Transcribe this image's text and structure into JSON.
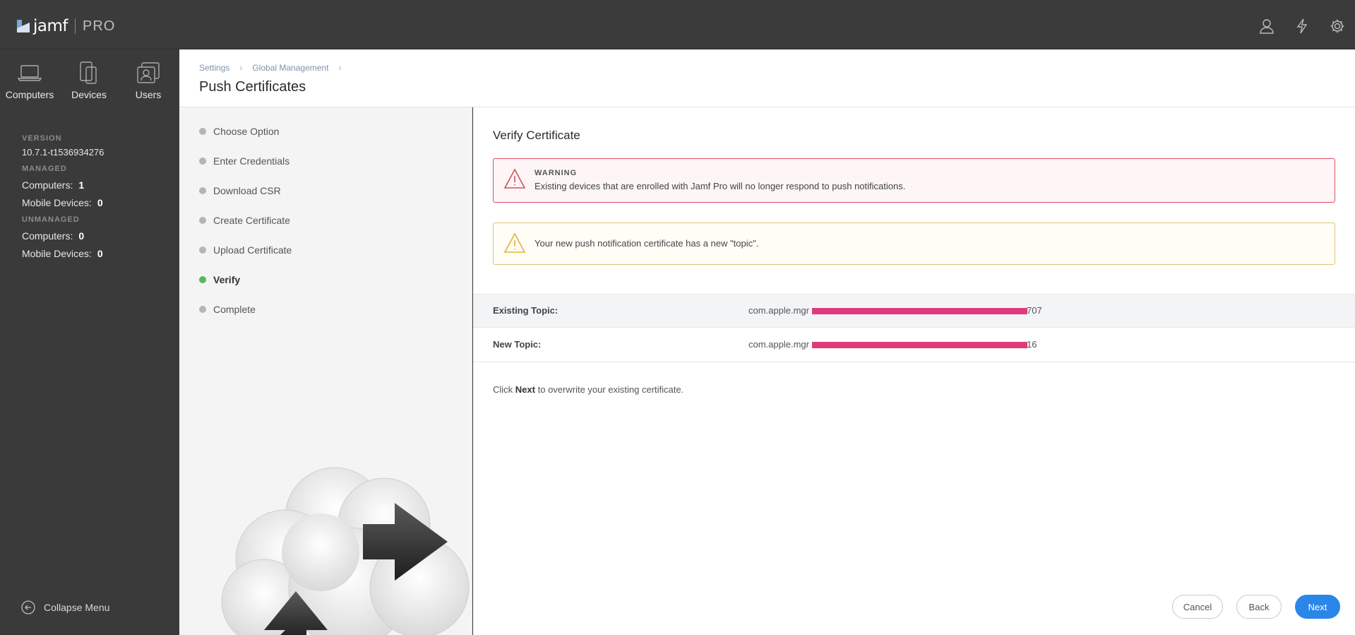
{
  "app": {
    "brand": "jamf",
    "product": "PRO"
  },
  "nav": [
    {
      "label": "Computers",
      "icon": "laptop-icon"
    },
    {
      "label": "Devices",
      "icon": "mobile-device-icon"
    },
    {
      "label": "Users",
      "icon": "users-icon"
    }
  ],
  "stats": {
    "version_label": "VERSION",
    "version": "10.7.1-t1536934276",
    "managed_label": "MANAGED",
    "unmanaged_label": "UNMANAGED",
    "managed_computers_label": "Computers:",
    "managed_computers": "1",
    "managed_mobile_label": "Mobile Devices:",
    "managed_mobile": "0",
    "unmanaged_computers_label": "Computers:",
    "unmanaged_computers": "0",
    "unmanaged_mobile_label": "Mobile Devices:",
    "unmanaged_mobile": "0"
  },
  "collapse_label": "Collapse Menu",
  "header": {
    "breadcrumb": [
      "Settings",
      "Global Management"
    ],
    "title": "Push Certificates"
  },
  "steps": [
    {
      "label": "Choose Option",
      "active": false
    },
    {
      "label": "Enter Credentials",
      "active": false
    },
    {
      "label": "Download CSR",
      "active": false
    },
    {
      "label": "Create Certificate",
      "active": false
    },
    {
      "label": "Upload Certificate",
      "active": false
    },
    {
      "label": "Verify",
      "active": true
    },
    {
      "label": "Complete",
      "active": false
    }
  ],
  "content": {
    "title": "Verify Certificate",
    "warning_title": "WARNING",
    "warning_text": "Existing devices that are enrolled with Jamf Pro will no longer respond to push notifications.",
    "info_text": "Your new push notification certificate has a new \"topic\".",
    "existing_topic_label": "Existing Topic:",
    "existing_topic_prefix": "com.apple.mgr",
    "existing_topic_suffix": "707",
    "new_topic_label": "New Topic:",
    "new_topic_prefix": "com.apple.mgr",
    "new_topic_suffix": "16",
    "note_pre": "Click",
    "note_bold": "Next",
    "note_post": "to overwrite your existing certificate."
  },
  "buttons": {
    "cancel": "Cancel",
    "back": "Back",
    "next": "Next"
  },
  "colors": {
    "accent": "#2a86e8",
    "active_step": "#5ab65a",
    "warning_border": "#d6505e",
    "info_border": "#e2c37c",
    "redaction": "#e03a7a"
  }
}
